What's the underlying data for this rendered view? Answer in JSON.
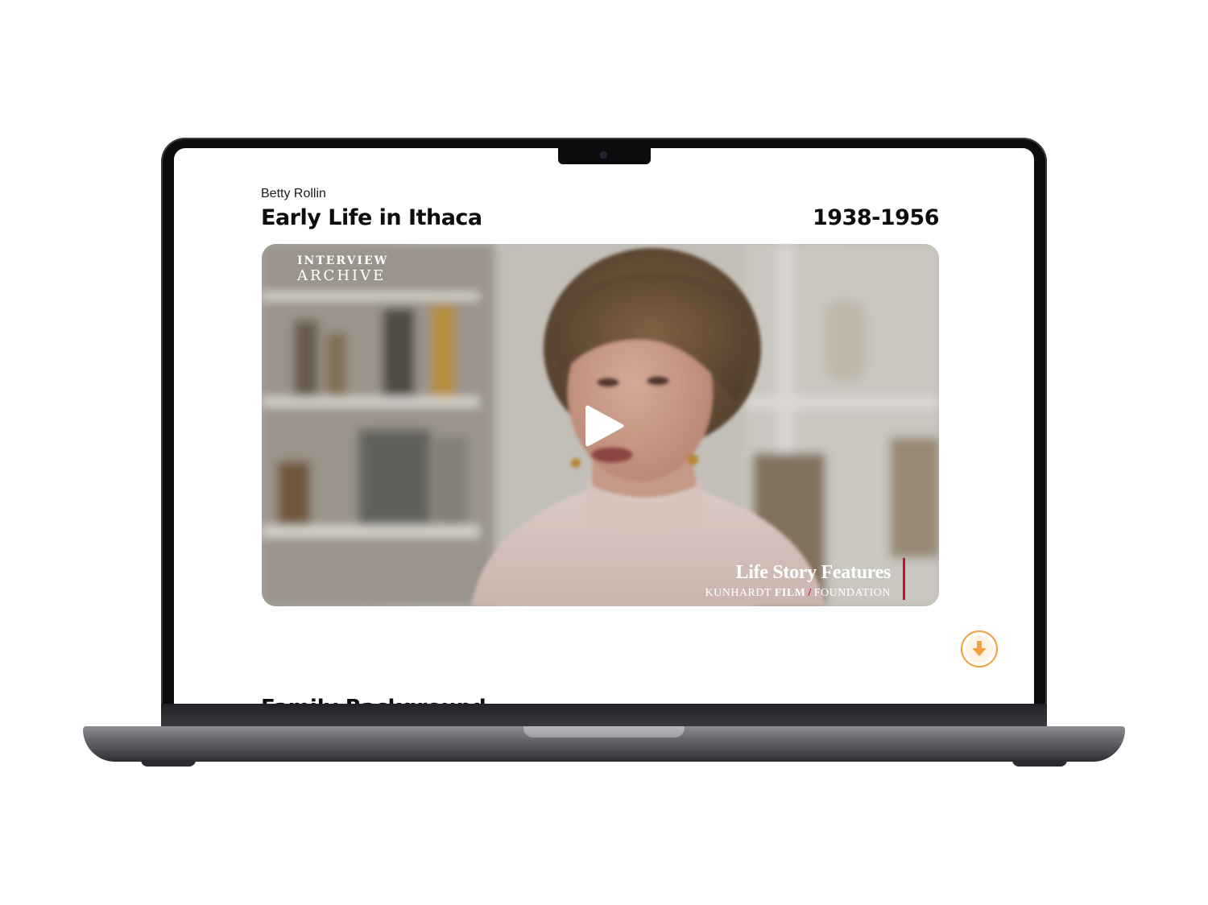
{
  "page": {
    "person_name": "Betty Rollin",
    "section_title": "Early Life in Ithaca",
    "years": "1938-1956",
    "next_section_title": "Family Background"
  },
  "video": {
    "archive_logo": {
      "line1": "INTERVIEW",
      "line2": "ARCHIVE"
    },
    "branding": {
      "title": "Life Story Features",
      "org_part1": "KUNHARDT",
      "org_part2": "FILM",
      "org_part3": "FOUNDATION"
    },
    "play_icon": "play-icon"
  },
  "download": {
    "icon": "arrow-down-icon",
    "accent_color": "#f2a03d"
  }
}
